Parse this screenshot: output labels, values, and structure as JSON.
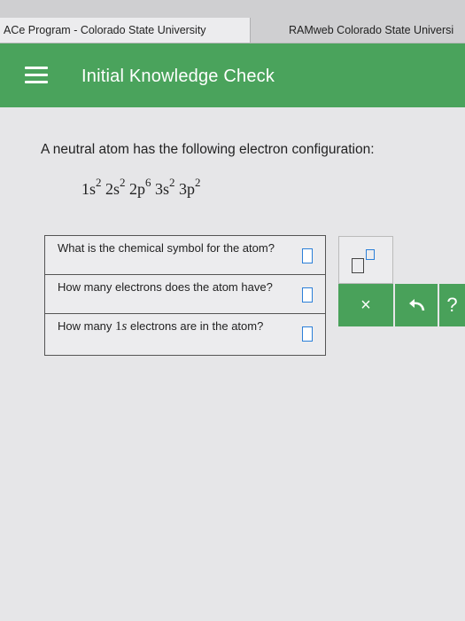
{
  "browser": {
    "tabs": [
      {
        "label": "ACe Program - Colorado State University"
      },
      {
        "label": "RAMweb Colorado State Universi"
      }
    ]
  },
  "header": {
    "title": "Initial Knowledge Check",
    "menu_icon": "hamburger-menu-icon",
    "background_color": "#4aa35c"
  },
  "question": {
    "prompt": "A neutral atom has the following electron configuration:",
    "configuration": [
      {
        "orbital": "1s",
        "exp": "2"
      },
      {
        "orbital": "2s",
        "exp": "2"
      },
      {
        "orbital": "2p",
        "exp": "6"
      },
      {
        "orbital": "3s",
        "exp": "2"
      },
      {
        "orbital": "3p",
        "exp": "2"
      }
    ]
  },
  "rows": [
    {
      "text": "What is the chemical symbol for the atom?",
      "value": ""
    },
    {
      "text": "How many electrons does the atom have?",
      "value": ""
    },
    {
      "text_before": "How many",
      "symbol_num": "1",
      "symbol_var": "s",
      "text_after": "electrons are in the atom?",
      "value": ""
    }
  ],
  "tools": {
    "superscript_icon": "superscript-template-icon",
    "clear_label": "×",
    "undo_icon": "undo-icon",
    "help_label": "?"
  }
}
